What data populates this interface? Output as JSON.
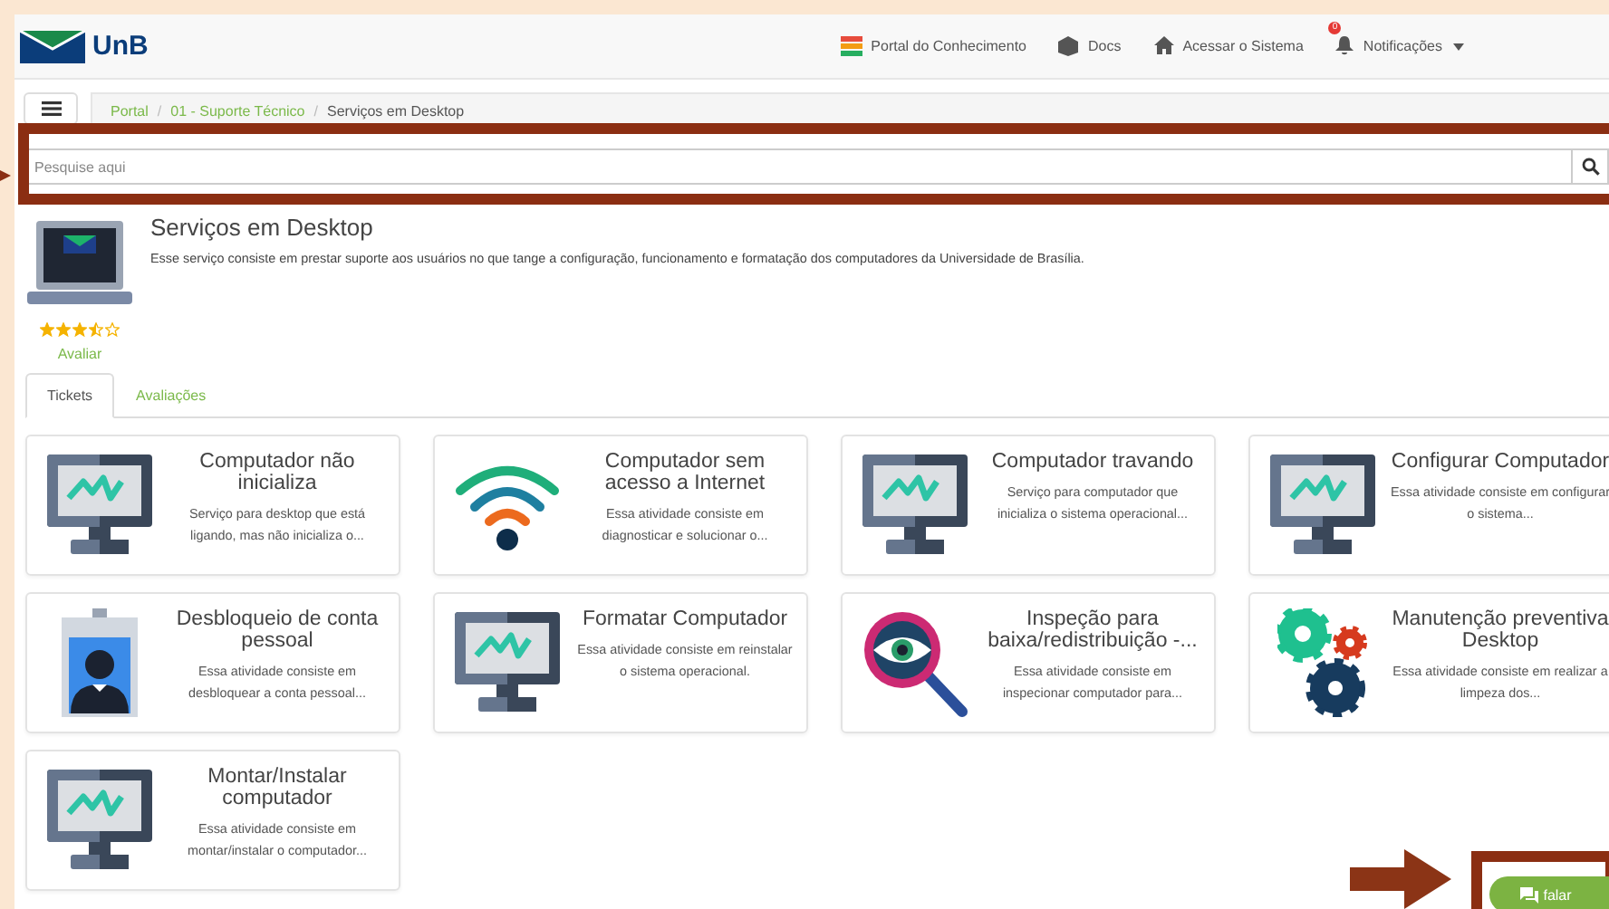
{
  "header": {
    "logo_text": "UnB",
    "nav": [
      {
        "label": "Portal do Conhecimento"
      },
      {
        "label": "Docs"
      },
      {
        "label": "Acessar o Sistema"
      },
      {
        "label": "Notificações",
        "badge": "0",
        "dropdown": true
      }
    ]
  },
  "breadcrumb": {
    "separator": "/",
    "items": [
      {
        "label": "Portal",
        "link": true
      },
      {
        "label": "01 - Suporte Técnico",
        "link": true
      },
      {
        "label": "Serviços em Desktop",
        "link": false
      }
    ]
  },
  "search": {
    "placeholder": "Pesquise aqui"
  },
  "service": {
    "title": "Serviços em Desktop",
    "description": "Esse serviço consiste em prestar suporte aos usuários no que tange a configuração, funcionamento e formatação dos computadores da Universidade de Brasília.",
    "stars": 3.5,
    "rate_link": "Avaliar"
  },
  "tabs": [
    {
      "label": "Tickets",
      "selected": true
    },
    {
      "label": "Avaliações",
      "selected": false
    }
  ],
  "cards": [
    {
      "kind": "monitor",
      "title": "Computador não inicializa",
      "description": "Serviço para desktop que está ligando, mas não inicializa o..."
    },
    {
      "kind": "wifi",
      "title": "Computador sem acesso a Internet",
      "description": "Essa atividade consiste em diagnosticar e solucionar o..."
    },
    {
      "kind": "monitor",
      "title": "Computador travando",
      "description": "Serviço para computador que inicializa o sistema operacional..."
    },
    {
      "kind": "monitor",
      "title": "Configurar Computador",
      "description": "Essa atividade consiste em configurar o sistema..."
    },
    {
      "kind": "badge",
      "title": "Desbloqueio de conta pessoal",
      "description": "Essa atividade consiste em desbloquear a conta pessoal..."
    },
    {
      "kind": "monitor",
      "title": "Formatar Computador",
      "description": "Essa atividade consiste em reinstalar o sistema operacional."
    },
    {
      "kind": "magnifier",
      "title": "Inspeção para baixa/redistribuição -...",
      "description": "Essa atividade consiste em inspecionar computador para..."
    },
    {
      "kind": "gears",
      "title": "Manutenção preventiva Desktop",
      "description": "Essa atividade consiste em realizar a limpeza dos..."
    },
    {
      "kind": "monitor",
      "title": "Montar/Instalar computador",
      "description": "Essa atividade consiste em montar/instalar o computador..."
    }
  ],
  "chat_button": {
    "label": "falar"
  }
}
